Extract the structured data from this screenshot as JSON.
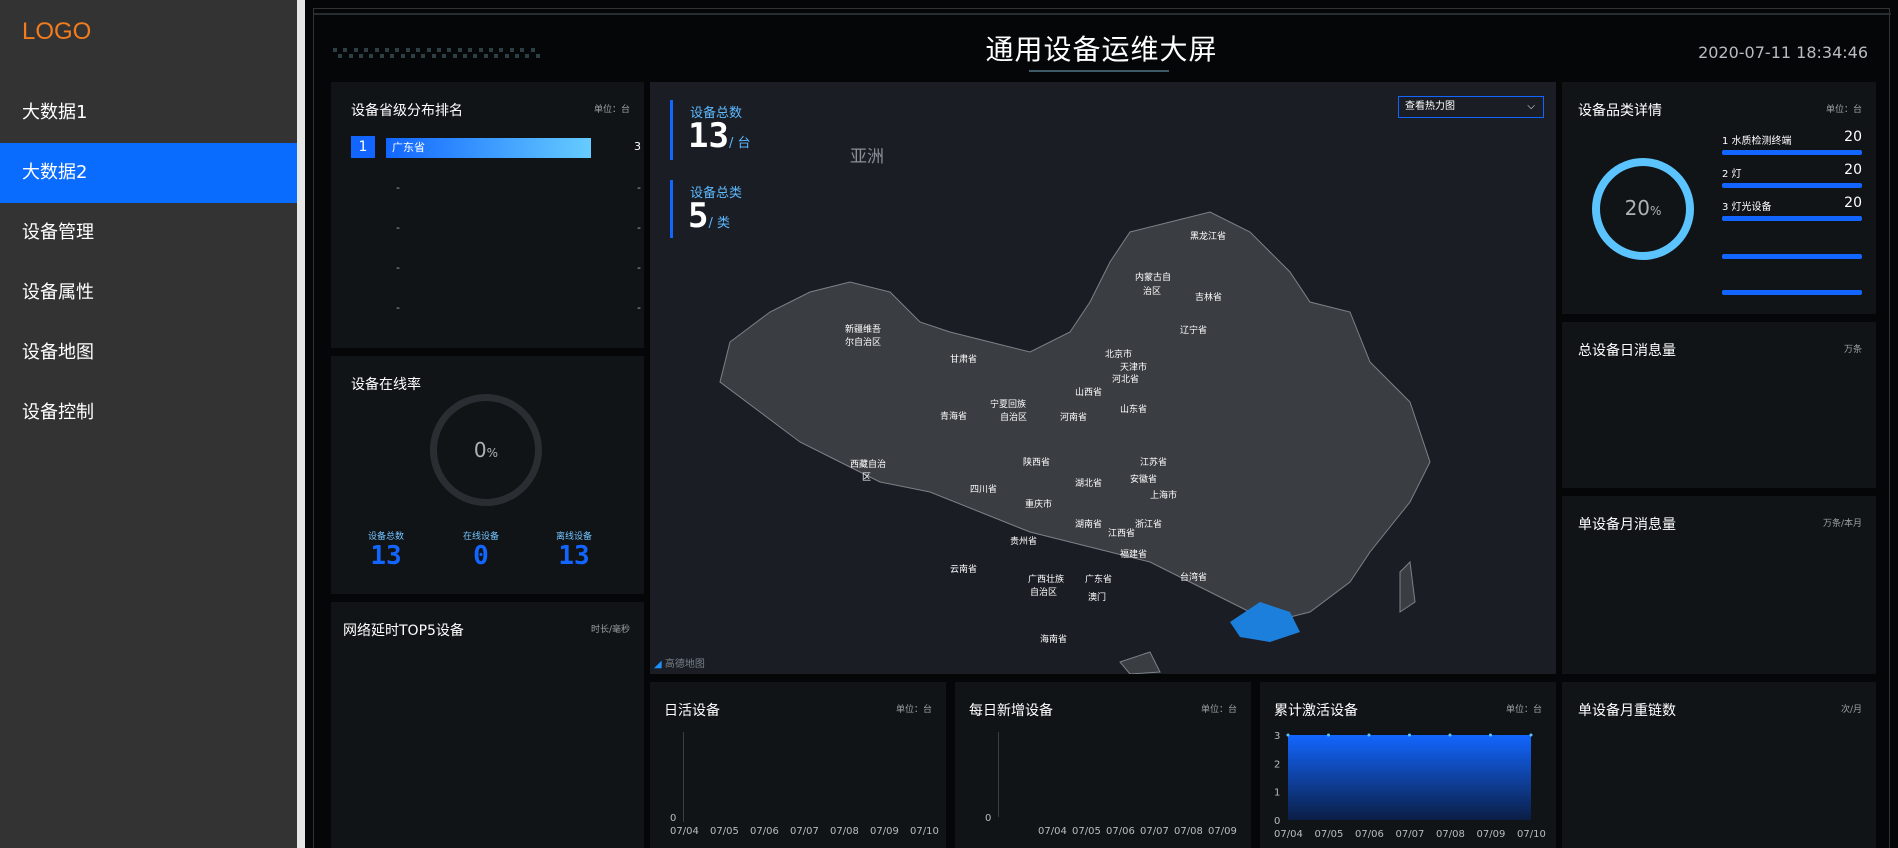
{
  "sidebar": {
    "logo": "LOGO",
    "items": [
      {
        "label": "大数据1",
        "active": false
      },
      {
        "label": "大数据2",
        "active": true
      },
      {
        "label": "设备管理",
        "active": false
      },
      {
        "label": "设备属性",
        "active": false
      },
      {
        "label": "设备地图",
        "active": false
      },
      {
        "label": "设备控制",
        "active": false
      }
    ]
  },
  "header": {
    "title": "通用设备运维大屏",
    "datetime": "2020-07-11 18:34:46"
  },
  "ranking": {
    "title": "设备省级分布排名",
    "unit": "单位：台",
    "rows": [
      {
        "rank": "1",
        "name": "广东省",
        "value": "3"
      },
      {
        "rank": "",
        "name": "-",
        "value": "-"
      },
      {
        "rank": "",
        "name": "-",
        "value": "-"
      },
      {
        "rank": "",
        "name": "-",
        "value": "-"
      },
      {
        "rank": "",
        "name": "-",
        "value": "-"
      }
    ]
  },
  "online": {
    "title": "设备在线率",
    "percent": "0",
    "percent_unit": "%",
    "stats": [
      {
        "label": "设备总数",
        "value": "13"
      },
      {
        "label": "在线设备",
        "value": "0"
      },
      {
        "label": "离线设备",
        "value": "13"
      }
    ]
  },
  "latency": {
    "title": "网络延时TOP5设备",
    "unit": "时长/毫秒"
  },
  "map": {
    "total_label": "设备总数",
    "total_value": "13",
    "total_unit": "/ 台",
    "types_label": "设备总类",
    "types_value": "5",
    "types_unit": "/ 类",
    "select_value": "查看热力图",
    "region_label": "亚洲",
    "attribution": "高德地图",
    "provinces": [
      "黑龙江省",
      "内蒙古自治区",
      "吉林省",
      "辽宁省",
      "北京市",
      "天津市",
      "河北省",
      "新疆维吾尔自治区",
      "甘肃省",
      "宁夏回族自治区",
      "山西省",
      "山东省",
      "青海省",
      "西藏自治区",
      "陕西省",
      "河南省",
      "江苏省",
      "安徽省",
      "上海市",
      "四川省",
      "湖北省",
      "重庆市",
      "浙江省",
      "湖南省",
      "江西省",
      "贵州省",
      "福建省",
      "云南省",
      "广西壮族自治区",
      "广东省",
      "台湾省",
      "海南省",
      "澳门"
    ],
    "highlight": "广东省"
  },
  "category": {
    "title": "设备品类详情",
    "unit": "单位：台",
    "percent": "20",
    "percent_unit": "%",
    "percent_value": 0.2,
    "items": [
      {
        "label": "1  水质检测终端",
        "value": "20"
      },
      {
        "label": "2  灯",
        "value": "20"
      },
      {
        "label": "3  灯光设备",
        "value": "20"
      }
    ]
  },
  "daily_msg": {
    "title": "总设备日消息量",
    "unit": "万条"
  },
  "monthly_msg": {
    "title": "单设备月消息量",
    "unit": "万条/本月"
  },
  "monthly_reconnect": {
    "title": "单设备月重链数",
    "unit": "次/月"
  },
  "daily_active": {
    "title": "日活设备",
    "unit": "单位：台",
    "zero": "0",
    "x": [
      "07/04",
      "07/05",
      "07/06",
      "07/07",
      "07/08",
      "07/09",
      "07/10"
    ]
  },
  "daily_new": {
    "title": "每日新增设备",
    "unit": "单位：台",
    "zero": "0",
    "x": [
      "07/04",
      "07/05",
      "07/06",
      "07/07",
      "07/08",
      "07/09"
    ]
  },
  "cumulative": {
    "title": "累计激活设备",
    "unit": "单位：台",
    "y_ticks": [
      "3",
      "2",
      "1",
      "0"
    ],
    "x": [
      "07/04",
      "07/05",
      "07/06",
      "07/07",
      "07/08",
      "07/09",
      "07/10"
    ]
  },
  "chart_data": {
    "type": "area",
    "title": "累计激活设备",
    "x": [
      "07/04",
      "07/05",
      "07/06",
      "07/07",
      "07/08",
      "07/09",
      "07/10"
    ],
    "series": [
      {
        "values": [
          3,
          3,
          3,
          3,
          3,
          3,
          3
        ]
      }
    ],
    "ylim": [
      0,
      3
    ]
  },
  "colors": {
    "accent": "#1266ff",
    "sidebar_active": "#0a6cff",
    "logo": "#f07c1e",
    "ring": "#5bc4ff",
    "highlight_province": "#1d7fdc"
  }
}
